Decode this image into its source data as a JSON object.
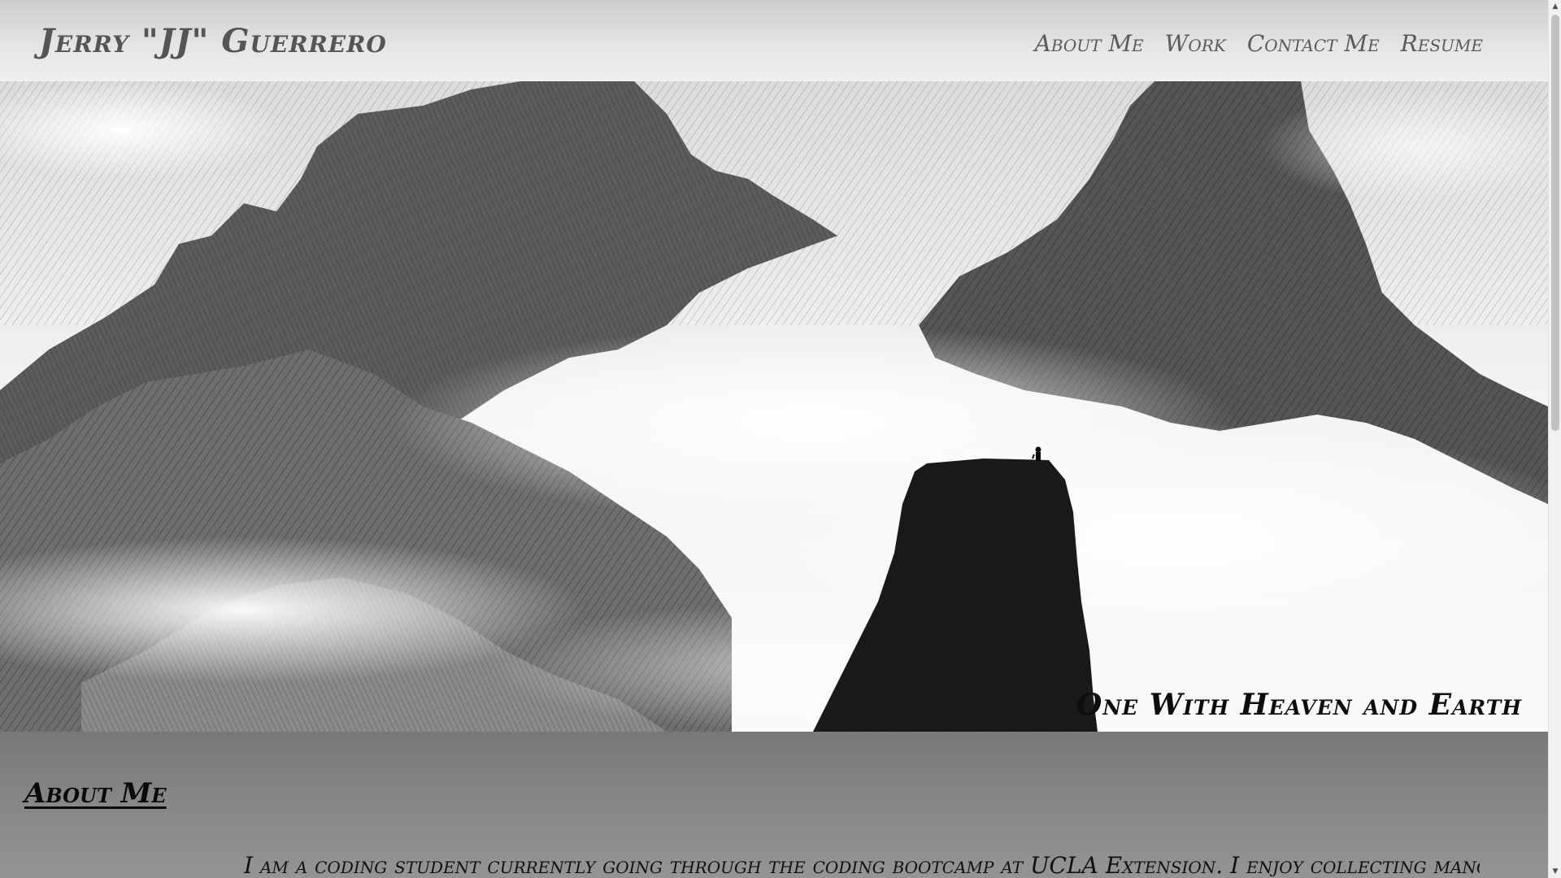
{
  "header": {
    "site_title": "Jerry \"JJ\" Guerrero",
    "nav": [
      {
        "label": "About Me"
      },
      {
        "label": "Work"
      },
      {
        "label": "Contact Me"
      },
      {
        "label": "Resume"
      }
    ]
  },
  "hero": {
    "caption": "One With Heaven and Earth"
  },
  "about": {
    "heading": "About Me",
    "text": "I am a coding student currently going through the coding bootcamp at UCLA Extension. I enjoy collecting manga and vinyl as"
  },
  "scrollbar": {
    "up_icon": "▲",
    "down_icon": "▼"
  },
  "colors": {
    "header_bg": "#dedede",
    "title_text": "#555555",
    "about_bg": "#808080",
    "caption_text": "#0d0d0d"
  }
}
